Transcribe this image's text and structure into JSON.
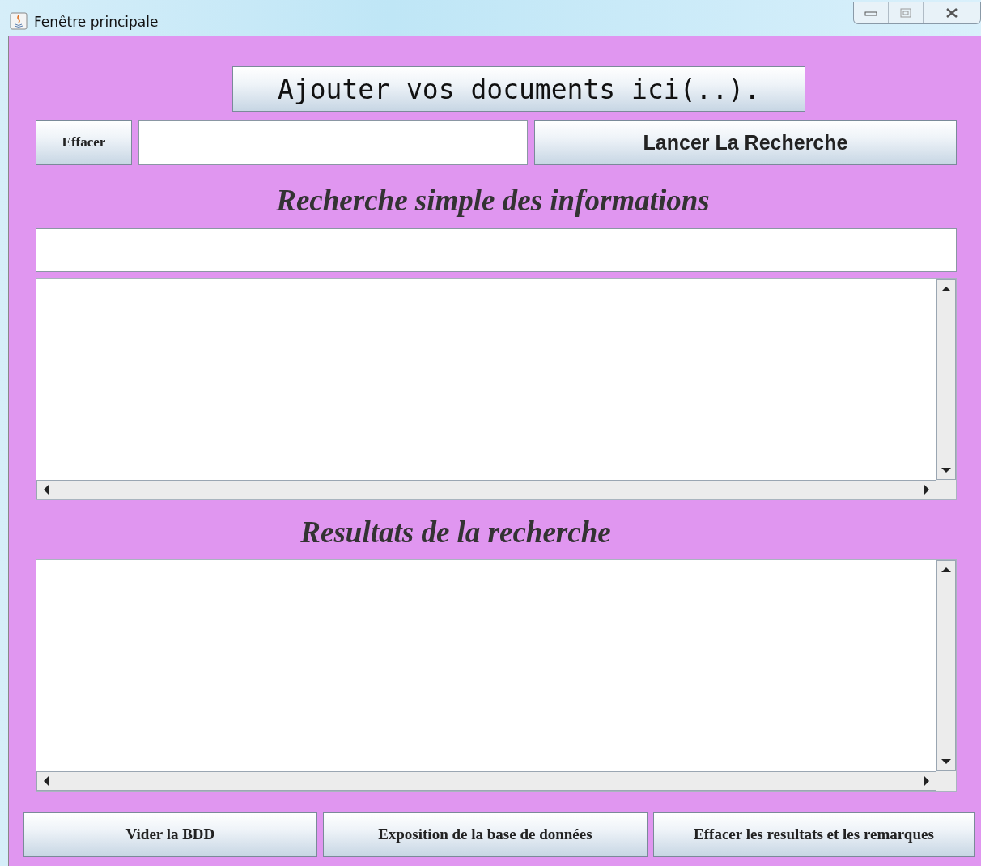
{
  "window": {
    "title": "Fenêtre principale"
  },
  "add_button": {
    "label": "Ajouter vos documents ici(..)."
  },
  "search_row": {
    "clear_button": "Effacer",
    "search_button": "Lancer La Recherche"
  },
  "simple_search": {
    "heading": "Recherche simple des informations"
  },
  "results": {
    "heading": "Resultats de la recherche"
  },
  "bottom_buttons": [
    {
      "label": "Vider la BDD"
    },
    {
      "label": "Exposition de la base de données"
    },
    {
      "label": "Effacer les resultats et les remarques"
    }
  ]
}
